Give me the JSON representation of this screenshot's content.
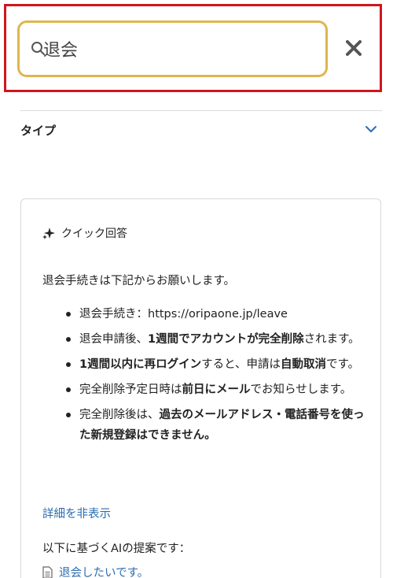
{
  "search": {
    "value": "退会",
    "icon": "search-icon",
    "clear_icon": "close-icon",
    "border_color": "#dfb64e",
    "highlight_color": "#d0151f"
  },
  "filter": {
    "label": "タイプ",
    "icon": "chevron-down-icon",
    "accent_color": "#2a6db0"
  },
  "quick_answer": {
    "title": "クイック回答",
    "icon": "sparkle-icon",
    "intro": "退会手続きは下記からお願いします。",
    "bullets": [
      [
        {
          "text": "退会手続き：https://oripaone.jp/leave",
          "bold": false
        }
      ],
      [
        {
          "text": "退会申請後、",
          "bold": false
        },
        {
          "text": "1週間でアカウントが完全削除",
          "bold": true
        },
        {
          "text": "されます。",
          "bold": false
        }
      ],
      [
        {
          "text": "1週間以内に再ログイン",
          "bold": true
        },
        {
          "text": "すると、申請は",
          "bold": false
        },
        {
          "text": "自動取消",
          "bold": true
        },
        {
          "text": "です。",
          "bold": false
        }
      ],
      [
        {
          "text": "完全削除予定日時は",
          "bold": false
        },
        {
          "text": "前日にメール",
          "bold": true
        },
        {
          "text": "でお知らせします。",
          "bold": false
        }
      ],
      [
        {
          "text": "完全削除後は、",
          "bold": false
        },
        {
          "text": "過去のメールアドレス・電話番号を使った新規登録はできません。",
          "bold": true
        }
      ]
    ],
    "toggle_label": "詳細を非表示",
    "suggestions_label": "以下に基づくAIの提案です：",
    "suggestions": [
      {
        "icon": "document-icon",
        "title": "退会したいです。"
      }
    ]
  }
}
